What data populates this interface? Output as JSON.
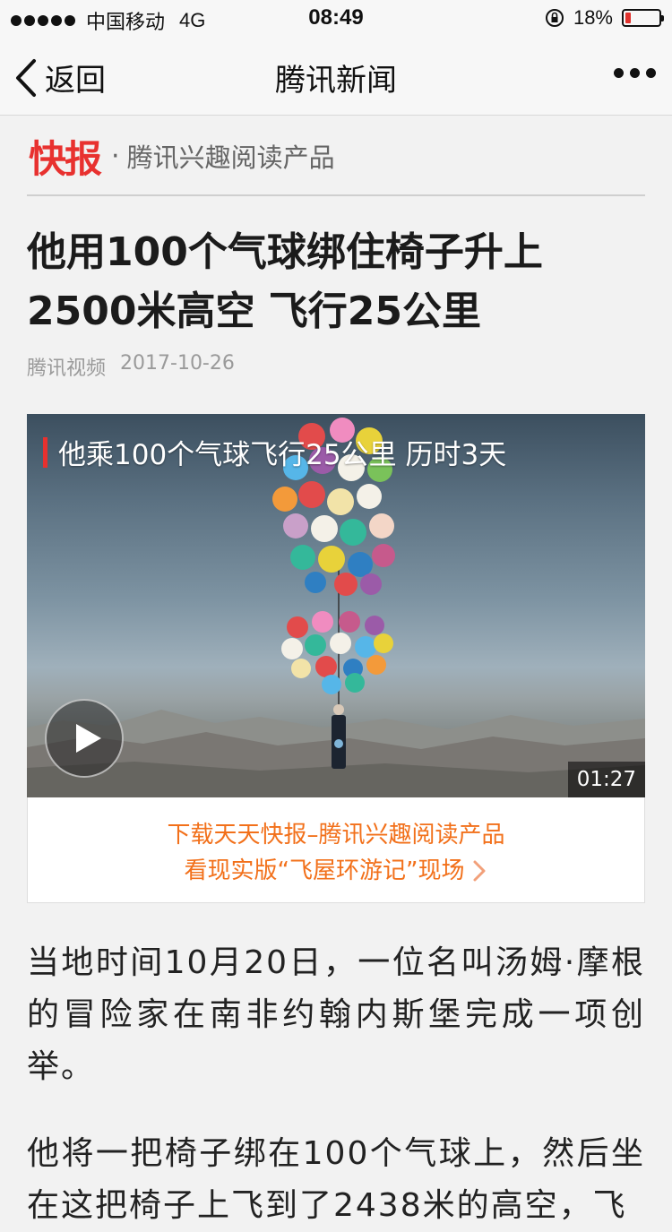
{
  "status_bar": {
    "carrier": "中国移动",
    "network": "4G",
    "time": "08:49",
    "battery_percent": "18%",
    "battery_level": 0.18
  },
  "nav": {
    "back_label": "返回",
    "title": "腾讯新闻"
  },
  "brand": {
    "logo": "快报",
    "separator": "·",
    "tagline": "腾讯兴趣阅读产品"
  },
  "article": {
    "headline_line1": "他用100个气球绑住椅子升上",
    "headline_line2": "2500米高空 飞行25公里",
    "source": "腾讯视频",
    "date": "2017-10-26"
  },
  "video": {
    "title": "他乘100个气球飞行25公里 历时3天",
    "duration": "01:27"
  },
  "download_banner": {
    "line1": "下载天天快报–腾讯兴趣阅读产品",
    "line2": "看现实版“飞屋环游记”现场"
  },
  "body": {
    "paragraph1": "当地时间10月20日，一位名叫汤姆·摩根的冒险家在南非约翰内斯堡完成一项创举。",
    "paragraph2": "他将一把椅子绑在100个气球上，然后坐在这把椅子上飞到了2438米的高空，飞"
  },
  "colors": {
    "brand_red": "#e8312f",
    "link_orange": "#f2701a",
    "battery_low": "#e0322d"
  }
}
